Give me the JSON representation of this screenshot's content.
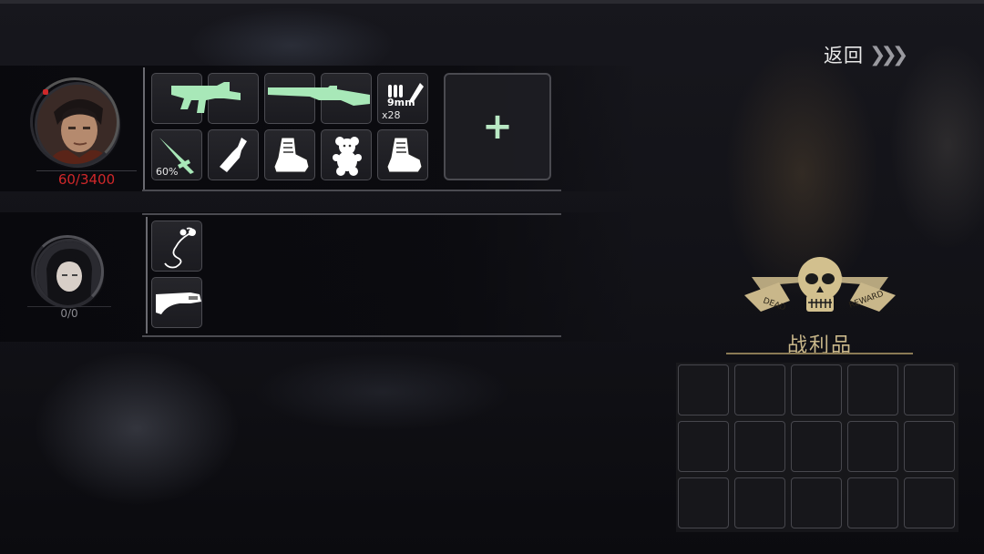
{
  "header": {
    "back_label": "返回",
    "back_chevrons": "❯❯❯"
  },
  "characters": [
    {
      "name_slot": "male-survivor",
      "hp_text": "60/3400",
      "hp_color": "#d0282a",
      "items": [
        {
          "name": "smg",
          "color": "#a8e8b8"
        },
        {
          "name": "shotgun",
          "color": "#a8e8b8"
        },
        {
          "name": "ammo-9mm",
          "label": "9mm",
          "count": "x28"
        },
        {
          "name": "knife",
          "color": "#a8e8b8",
          "durability": "60%"
        },
        {
          "name": "bottle"
        },
        {
          "name": "boots"
        },
        {
          "name": "teddy-bear"
        },
        {
          "name": "boots"
        }
      ],
      "add_slot_symbol": "+"
    },
    {
      "name_slot": "female-survivor",
      "hp_text": "0/0",
      "hp_color": "#8a8a90",
      "items": [
        {
          "name": "earphones"
        },
        {
          "name": "sawed-off-shotgun"
        }
      ]
    }
  ],
  "loot": {
    "title": "战利品",
    "emblem_words": [
      "DEAD",
      "REWARD"
    ],
    "accent": "#c9b78a",
    "grid": {
      "rows": 3,
      "cols": 5
    }
  }
}
